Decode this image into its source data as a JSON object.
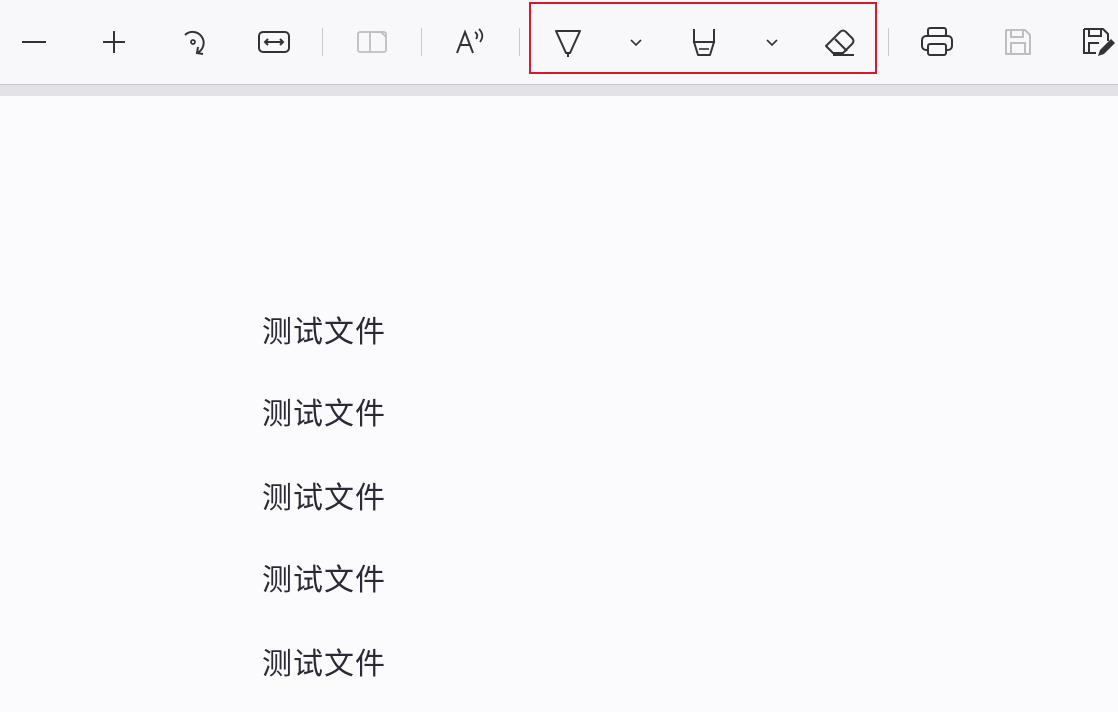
{
  "toolbar": {
    "buttons": [
      {
        "name": "zoom-out-button",
        "icon": "minus-icon",
        "enabled": true
      },
      {
        "name": "zoom-in-button",
        "icon": "plus-icon",
        "enabled": true
      },
      {
        "name": "rotate-button",
        "icon": "rotate-icon",
        "enabled": true
      },
      {
        "name": "fit-to-width-button",
        "icon": "fit-width-icon",
        "enabled": true
      },
      {
        "name": "page-view-button",
        "icon": "two-page-icon",
        "enabled": false
      },
      {
        "name": "read-aloud-button",
        "icon": "read-aloud-icon",
        "enabled": true
      },
      {
        "name": "draw-button",
        "icon": "pen-icon",
        "enabled": true
      },
      {
        "name": "draw-options-button",
        "icon": "chevron-down-icon",
        "enabled": true
      },
      {
        "name": "highlight-button",
        "icon": "highlighter-icon",
        "enabled": true
      },
      {
        "name": "highlight-options-button",
        "icon": "chevron-down-icon",
        "enabled": true
      },
      {
        "name": "erase-button",
        "icon": "eraser-icon",
        "enabled": true
      },
      {
        "name": "print-button",
        "icon": "printer-icon",
        "enabled": true
      },
      {
        "name": "save-button",
        "icon": "save-icon",
        "enabled": false
      },
      {
        "name": "save-as-button",
        "icon": "save-as-icon",
        "enabled": true
      }
    ],
    "highlight_color": "#d11a2a"
  },
  "document": {
    "lines": [
      "测试文件",
      "测试文件",
      "测试文件",
      "测试文件",
      "测试文件"
    ]
  }
}
